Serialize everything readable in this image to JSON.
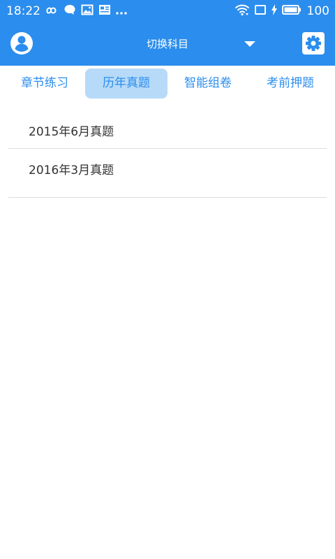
{
  "status_bar": {
    "time": "18:22",
    "battery": "100",
    "left_icons": [
      "infinity-icon",
      "chat-bubble-icon",
      "image-icon",
      "news-icon",
      "more-icon"
    ],
    "right_icons": [
      "wifi-icon",
      "screen-icon",
      "charging-icon",
      "battery-icon"
    ]
  },
  "header": {
    "subject_switch_label": "切换科目",
    "left_icon": "user-avatar-icon",
    "right_icon": "settings-gear-icon"
  },
  "tabs": [
    {
      "label": "章节练习",
      "active": false
    },
    {
      "label": "历年真题",
      "active": true
    },
    {
      "label": "智能组卷",
      "active": false
    },
    {
      "label": "考前押题",
      "active": false
    }
  ],
  "papers": [
    {
      "label": "2015年6月真题"
    },
    {
      "label": "2016年3月真题"
    }
  ],
  "colors": {
    "primary": "#2b8ded",
    "active_tab_bg": "#b7daf8",
    "text": "#333333",
    "divider": "#dddddd"
  }
}
